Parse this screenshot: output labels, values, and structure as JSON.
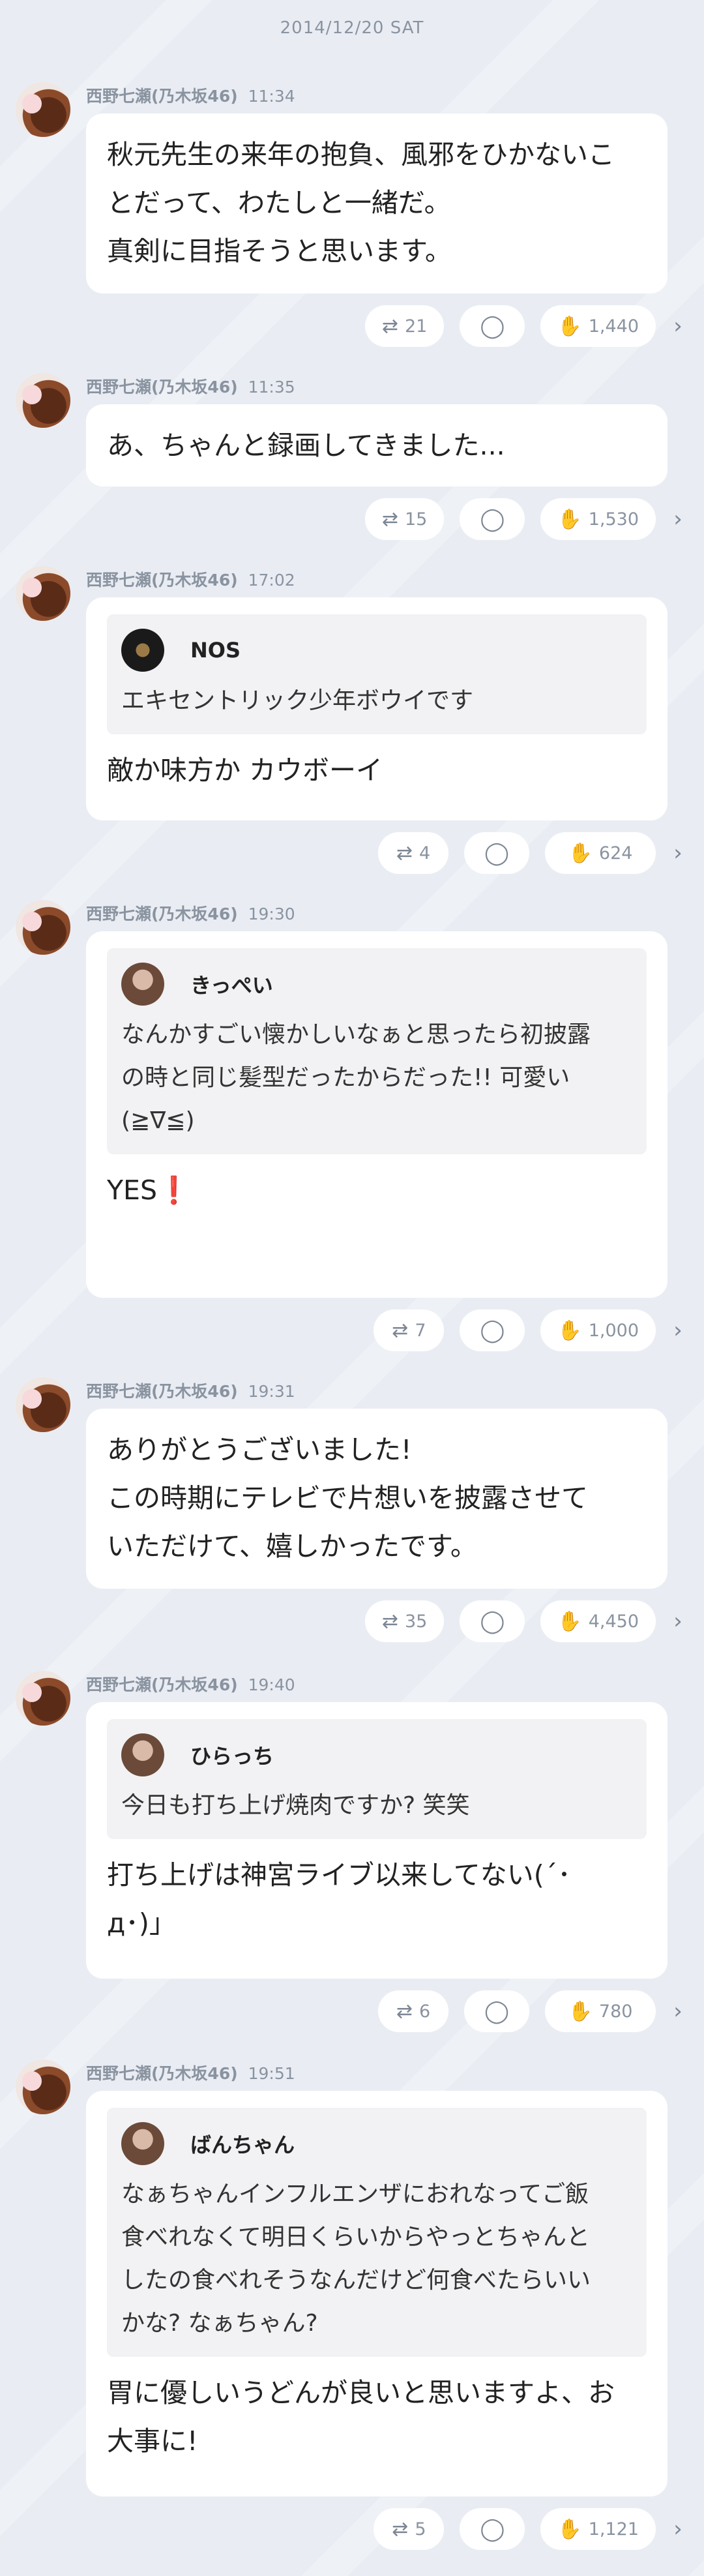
{
  "date_header": "2014/12/20 SAT",
  "posts": [
    {
      "author": "西野七瀬(乃木坂46)",
      "time": "11:34",
      "message": "秋元先生の来年の抱負、風邪をひかないこ\nとだって、わたしと一緒だ。\n真剣に目指そうと思います。",
      "retweets": "21",
      "likes": "1,440"
    },
    {
      "author": "西野七瀬(乃木坂46)",
      "time": "11:35",
      "message": "あ、ちゃんと録画してきました...",
      "retweets": "15",
      "likes": "1,530"
    },
    {
      "author": "西野七瀬(乃木坂46)",
      "time": "17:02",
      "quote": {
        "name": "NOS",
        "text": "エキセントリック少年ボウイです"
      },
      "message": "敵か味方か カウボーイ",
      "retweets": "4",
      "likes": "624"
    },
    {
      "author": "西野七瀬(乃木坂46)",
      "time": "19:30",
      "quote": {
        "name": "きっぺい",
        "text": "なんかすごい懐かしいなぁと思ったら初披露\nの時と同じ髪型だったからだった!! 可愛い\n(≧∇≦)"
      },
      "message": "YES❗️",
      "retweets": "7",
      "likes": "1,000"
    },
    {
      "author": "西野七瀬(乃木坂46)",
      "time": "19:31",
      "message": "ありがとうございました!\nこの時期にテレビで片想いを披露させて\nいただけて、嬉しかったです。",
      "retweets": "35",
      "likes": "4,450"
    },
    {
      "author": "西野七瀬(乃木坂46)",
      "time": "19:40",
      "quote": {
        "name": "ひらっち",
        "text": "今日も打ち上げ焼肉ですか? 笑笑"
      },
      "message": "打ち上げは神宮ライブ以来してない(´･\nд･)」",
      "retweets": "6",
      "likes": "780"
    },
    {
      "author": "西野七瀬(乃木坂46)",
      "time": "19:51",
      "quote": {
        "name": "ばんちゃん",
        "text": "なぁちゃんインフルエンザにおれなってご飯\n食べれなくて明日くらいからやっとちゃんと\nしたの食べれそうなんだけど何食べたらいい\nかな? なぁちゃん?"
      },
      "message": "胃に優しいうどんが良いと思いますよ、お\n大事に!",
      "retweets": "5",
      "likes": "1,121"
    }
  ]
}
